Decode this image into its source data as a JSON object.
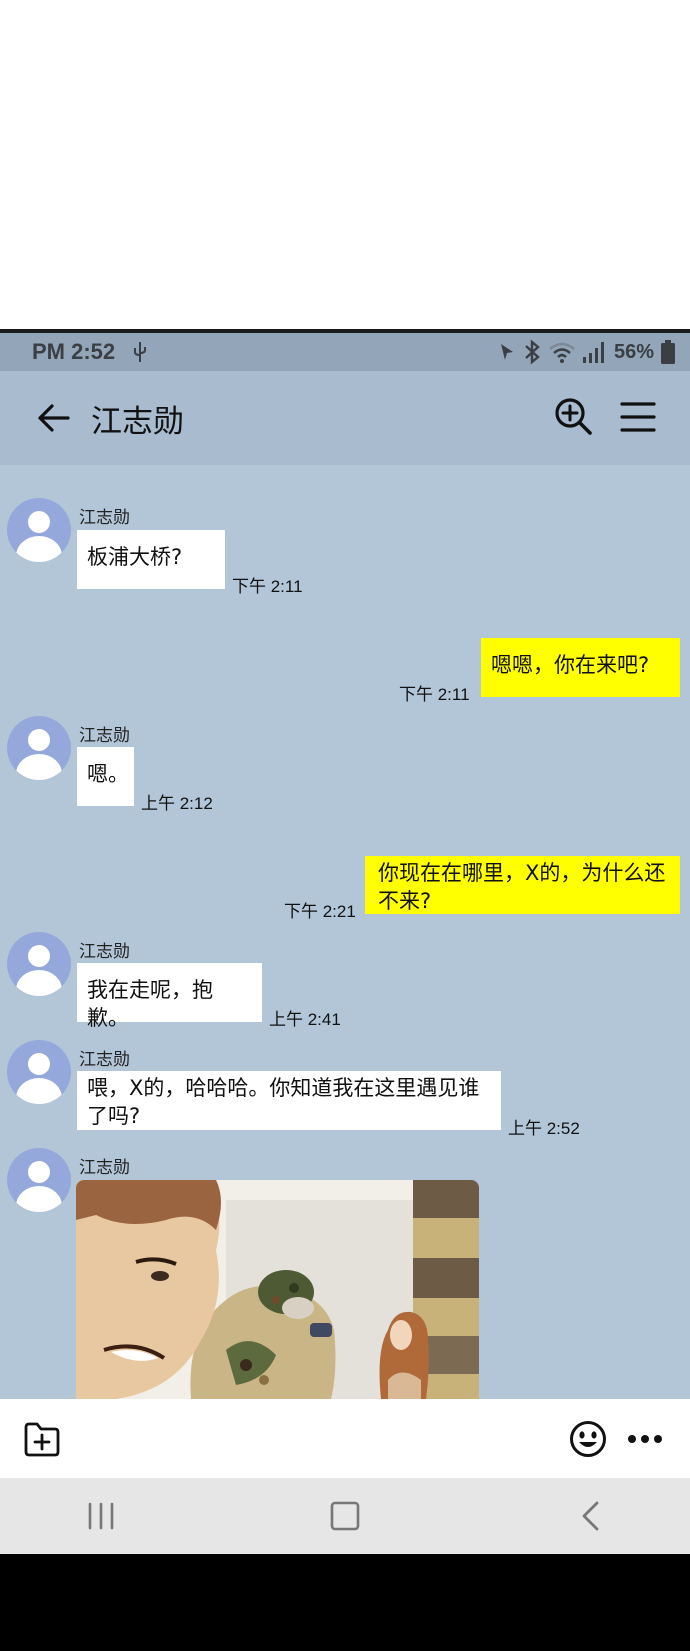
{
  "status_bar": {
    "time": "PM 2:52",
    "battery_percent": "56%"
  },
  "header": {
    "title": "江志勋"
  },
  "messages": [
    {
      "direction": "in",
      "sender": "江志勋",
      "text": "板浦大桥?",
      "time": "下午 2:11"
    },
    {
      "direction": "out",
      "text": "嗯嗯，你在来吧?",
      "time": "下午 2:11"
    },
    {
      "direction": "in",
      "sender": "江志勋",
      "text": "嗯。",
      "time": "上午 2:12"
    },
    {
      "direction": "out",
      "text": "你现在在哪里，X的，为什么还不来?",
      "time": "下午 2:21"
    },
    {
      "direction": "in",
      "sender": "江志勋",
      "text": "我在走呢，抱歉。",
      "time": "上午 2:41"
    },
    {
      "direction": "in",
      "sender": "江志勋",
      "text": "喂，X的，哈哈哈。你知道我在这里遇见谁了吗?",
      "time": "上午 2:52"
    },
    {
      "direction": "in",
      "sender": "江志勋",
      "type": "image"
    }
  ],
  "icons": {
    "back": "arrow-left-icon",
    "search": "zoom-in-icon",
    "menu": "hamburger-menu-icon",
    "attach": "add-file-icon",
    "emoji": "smiley-icon",
    "more": "more-dots-icon"
  },
  "colors": {
    "chat_background": "#b2c6d8",
    "header_background": "#a9bccf",
    "outgoing_bubble": "#ffff00",
    "incoming_bubble": "#ffffff",
    "avatar": "#95a8dc"
  }
}
